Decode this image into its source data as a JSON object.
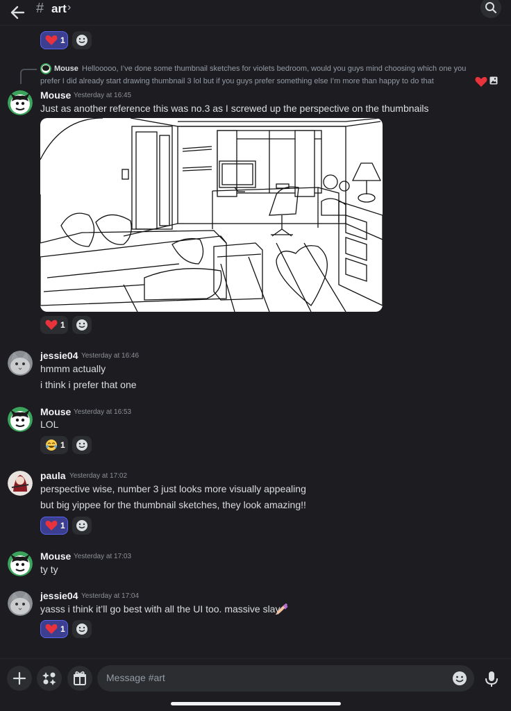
{
  "header": {
    "hash": "#",
    "channel": "art",
    "chevron": "›"
  },
  "reply": {
    "author": "Mouse",
    "line1": "Hellooooo, I’ve done some thumbnail sketches for violets bedroom, would you guys mind choosing which one you",
    "line2": "prefer I did already start drawing thumbnail 3 lol but if you guys prefer something else I’m more than happy to do that"
  },
  "messages": [
    {
      "author": "Mouse",
      "time": "Yesterday at 16:45",
      "text": "Just as another reference this was no.3 as I screwed up the perspective on the thumbnails"
    },
    {
      "author": "jessie04",
      "time": "Yesterday at 16:46",
      "text": "hmmm actually",
      "text2": "i think i prefer that one"
    },
    {
      "author": "Mouse",
      "time": "Yesterday at 16:53",
      "text": "LOL"
    },
    {
      "author": "paula",
      "time": "Yesterday at 17:02",
      "text": "perspective wise, number 3 just looks more visually appealing",
      "text2": "but big yippee for the thumbnail sketches, they look amazing!!"
    },
    {
      "author": "Mouse",
      "time": "Yesterday at 17:03",
      "text": "ty ty"
    },
    {
      "author": "jessie04",
      "time": "Yesterday at 17:04",
      "text": "yasss i think it’ll go best with all the UI too. massive slay"
    }
  ],
  "reactions": {
    "top": "1",
    "image_post": "1",
    "lol": "1",
    "paula": "1",
    "last": "1"
  },
  "composer": {
    "placeholder": "Message #art"
  },
  "colors": {
    "background": "#1c1c21",
    "reaction_active": "#3c3f8f",
    "accent": "#5865f2",
    "surface": "#2b2d31"
  }
}
